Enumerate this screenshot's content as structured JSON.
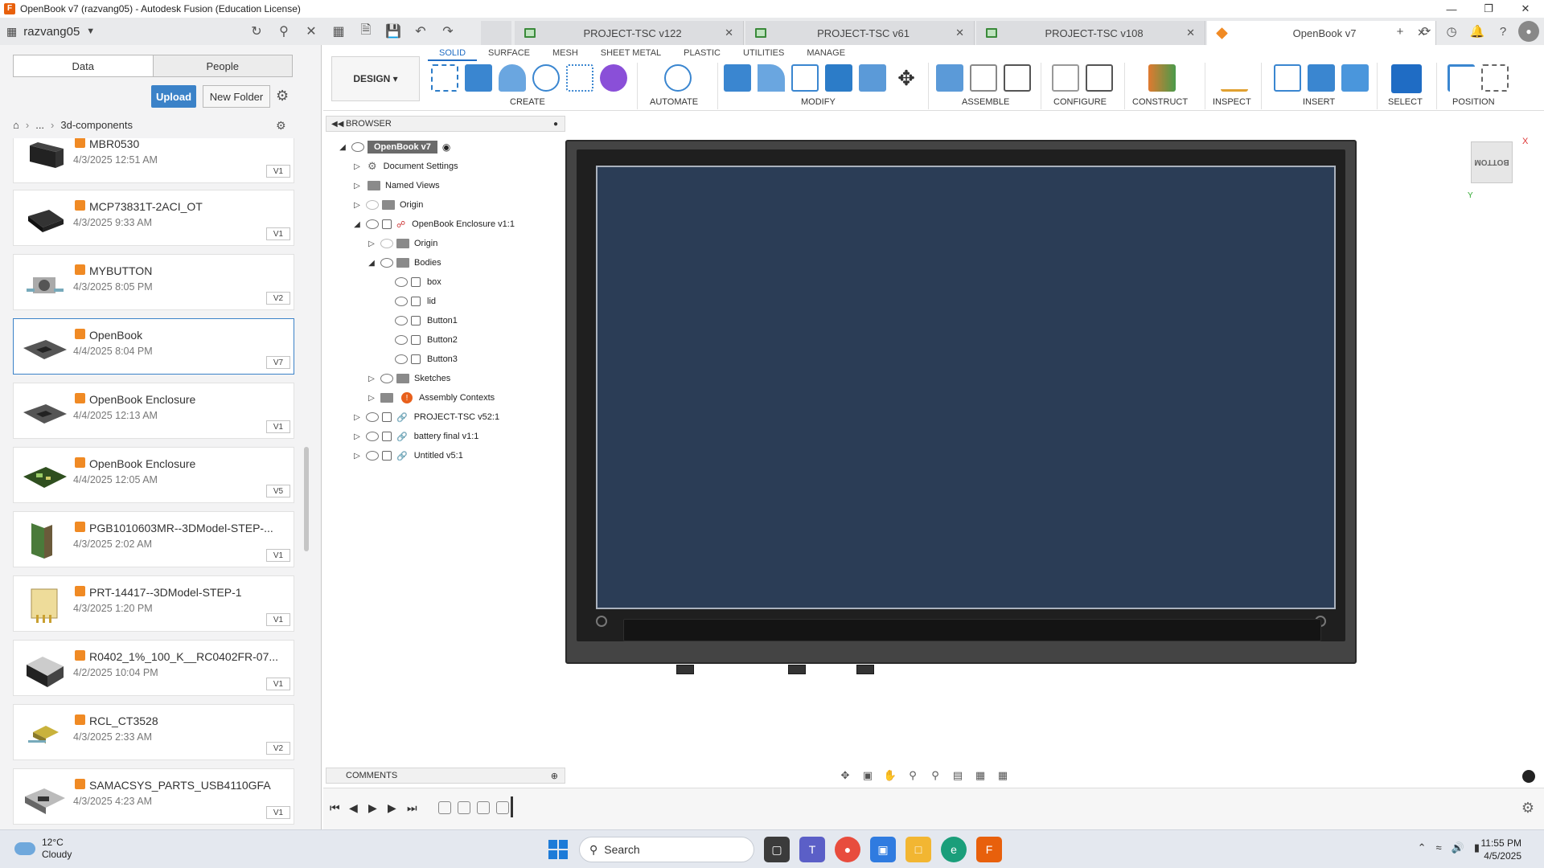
{
  "window": {
    "title": "OpenBook v7 (razvang05) - Autodesk Fusion (Education License)"
  },
  "topbar": {
    "username": "razvang05"
  },
  "tabs": [
    {
      "label": "PROJECT-TSC v122"
    },
    {
      "label": "PROJECT-TSC v61"
    },
    {
      "label": "PROJECT-TSC v108"
    },
    {
      "label": "OpenBook v7"
    }
  ],
  "datapanel": {
    "tab_data": "Data",
    "tab_people": "People",
    "upload": "Upload",
    "new_folder": "New Folder",
    "breadcrumb_more": "...",
    "breadcrumb_folder": "3d-components",
    "items": [
      {
        "name": "MBR0530",
        "date": "4/3/2025 12:51 AM",
        "version": "V1"
      },
      {
        "name": "MCP73831T-2ACI_OT",
        "date": "4/3/2025 9:33 AM",
        "version": "V1"
      },
      {
        "name": "MYBUTTON",
        "date": "4/3/2025 8:05 PM",
        "version": "V2"
      },
      {
        "name": "OpenBook",
        "date": "4/4/2025 8:04 PM",
        "version": "V7"
      },
      {
        "name": "OpenBook Enclosure",
        "date": "4/4/2025 12:13 AM",
        "version": "V1"
      },
      {
        "name": "OpenBook Enclosure",
        "date": "4/4/2025 12:05 AM",
        "version": "V5"
      },
      {
        "name": "PGB1010603MR--3DModel-STEP-...",
        "date": "4/3/2025 2:02 AM",
        "version": "V1"
      },
      {
        "name": "PRT-14417--3DModel-STEP-1",
        "date": "4/3/2025 1:20 PM",
        "version": "V1"
      },
      {
        "name": "R0402_1%_100_K__RC0402FR-07...",
        "date": "4/2/2025 10:04 PM",
        "version": "V1"
      },
      {
        "name": "RCL_CT3528",
        "date": "4/3/2025 2:33 AM",
        "version": "V2"
      },
      {
        "name": "SAMACSYS_PARTS_USB4110GFA",
        "date": "4/3/2025 4:23 AM",
        "version": "V1"
      }
    ]
  },
  "toolbar": {
    "design": "DESIGN",
    "workspaces": [
      "SOLID",
      "SURFACE",
      "MESH",
      "SHEET METAL",
      "PLASTIC",
      "UTILITIES",
      "MANAGE"
    ],
    "groups": [
      "CREATE",
      "AUTOMATE",
      "MODIFY",
      "ASSEMBLE",
      "CONFIGURE",
      "CONSTRUCT",
      "INSPECT",
      "INSERT",
      "SELECT",
      "POSITION"
    ]
  },
  "browser": {
    "title": "BROWSER",
    "root": "OpenBook v7",
    "nodes": {
      "doc_settings": "Document Settings",
      "named_views": "Named Views",
      "origin": "Origin",
      "enclosure": "OpenBook Enclosure v1:1",
      "origin2": "Origin",
      "bodies": "Bodies",
      "box": "box",
      "lid": "lid",
      "button1": "Button1",
      "button2": "Button2",
      "button3": "Button3",
      "sketches": "Sketches",
      "assembly_contexts": "Assembly Contexts",
      "project_tsc": "PROJECT-TSC v52:1",
      "battery": "battery final v1:1",
      "untitled": "Untitled v5:1"
    }
  },
  "viewcube": {
    "face": "BOTTOM",
    "x_axis": "X",
    "y_axis": "Y"
  },
  "comments": {
    "title": "COMMENTS"
  },
  "taskbar": {
    "temp": "12°C",
    "weather": "Cloudy",
    "search": "Search",
    "time": "11:55 PM",
    "date": "4/5/2025"
  },
  "colors": {
    "accent": "#1f6cc4",
    "upload": "#3b82c8",
    "fusion_orange": "#f08a24",
    "screen": "#2b3d56"
  }
}
